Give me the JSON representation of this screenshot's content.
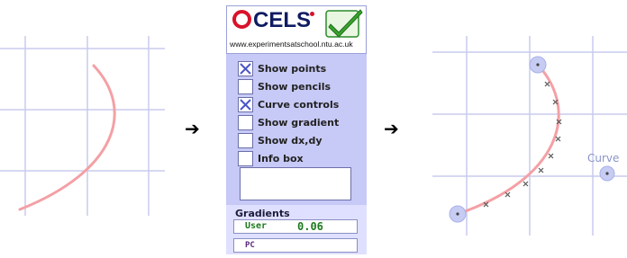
{
  "logo": {
    "brand": "CELS",
    "url": "www.experimentsatschool.ntu.ac.uk",
    "check_icon": "green-check-icon",
    "colors": {
      "red": "#d8122a",
      "navy": "#0f1c62",
      "green": "#3aa32a"
    }
  },
  "arrows": {
    "glyph": "➔"
  },
  "options": [
    {
      "label": "Show points",
      "checked": true
    },
    {
      "label": "Show pencils",
      "checked": false
    },
    {
      "label": "Curve controls",
      "checked": true
    },
    {
      "label": "Show gradient",
      "checked": false
    },
    {
      "label": "Show dx,dy",
      "checked": false
    },
    {
      "label": "Info box",
      "checked": false
    }
  ],
  "gradients": {
    "title": "Gradients",
    "user_label": "User",
    "user_value": "0.06",
    "pc_label": "PC",
    "pc_value": ""
  },
  "right_plot": {
    "curve_label": "Curve"
  },
  "colors": {
    "grid": "#c8cbee",
    "curve": "#f4a0a5",
    "panel_bg": "#c7c9f6",
    "handle": "#b9c0ee"
  }
}
